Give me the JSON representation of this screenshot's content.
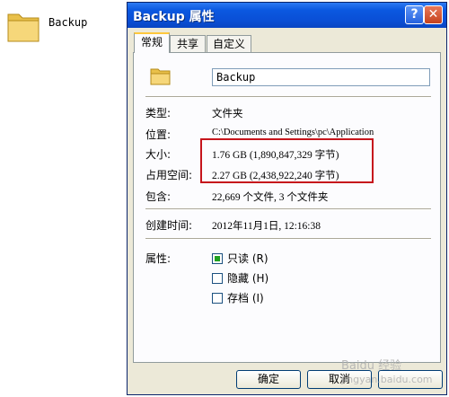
{
  "desktop": {
    "folder_label": "Backup"
  },
  "window": {
    "title": "Backup 属性",
    "help_glyph": "?",
    "close_glyph": "✕"
  },
  "tabs": [
    {
      "label": "常规",
      "active": true
    },
    {
      "label": "共享",
      "active": false
    },
    {
      "label": "自定义",
      "active": false
    }
  ],
  "general": {
    "name_value": "Backup",
    "type_label": "类型:",
    "type_value": "文件夹",
    "location_label": "位置:",
    "location_value": "C:\\Documents and Settings\\pc\\Application",
    "size_label": "大小:",
    "size_value": "1.76 GB (1,890,847,329 字节)",
    "size_on_disk_label": "占用空间:",
    "size_on_disk_value": "2.27 GB (2,438,922,240 字节)",
    "contains_label": "包含:",
    "contains_value": "22,669 个文件, 3 个文件夹",
    "created_label": "创建时间:",
    "created_value": "2012年11月1日, 12:16:38",
    "attributes_label": "属性:",
    "attributes": [
      {
        "label": "只读 (R)",
        "checked": true
      },
      {
        "label": "隐藏 (H)",
        "checked": false
      },
      {
        "label": "存档 (I)",
        "checked": false
      }
    ]
  },
  "buttons": {
    "ok": "确定",
    "cancel": "取消"
  },
  "watermark": {
    "text": "Baidu 经验",
    "sub": "jingyan.baidu.com"
  },
  "colors": {
    "titlebar": "#0a4fd6",
    "highlight": "#c6151c",
    "dialog_bg": "#ece9d8"
  }
}
